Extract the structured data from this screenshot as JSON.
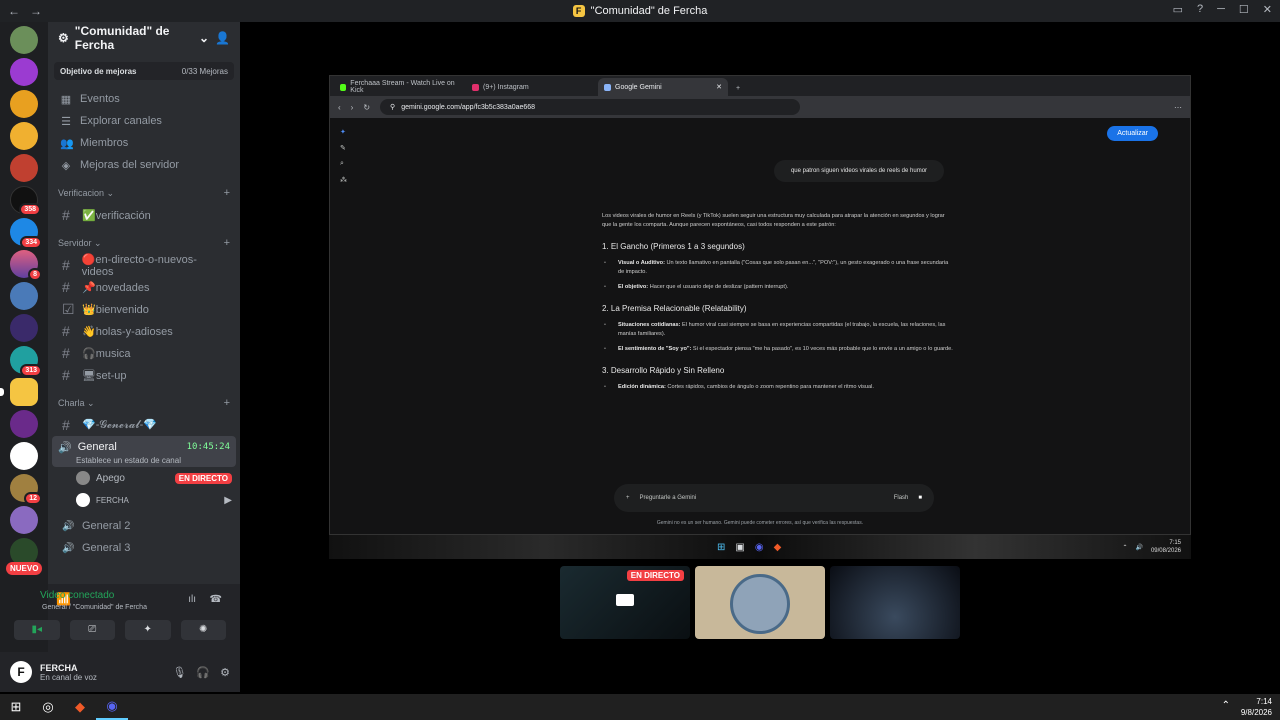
{
  "window": {
    "title": "\"Comunidad\" de Fercha",
    "logo_letter": "F"
  },
  "server": {
    "name": "\"Comunidad\" de Fercha",
    "boost": {
      "label": "Objetivo de mejoras",
      "value": "0/33 Mejoras"
    },
    "nav": [
      "Eventos",
      "Explorar canales",
      "Miembros",
      "Mejoras del servidor"
    ],
    "categories": {
      "verificacion": {
        "label": "Verificacion",
        "channels": [
          "✅verificación"
        ]
      },
      "servidor": {
        "label": "Servidor",
        "channels": [
          "🔴en-directo-o-nuevos-videos",
          "📌novedades",
          "👑bienvenido",
          "👋holas-y-adioses",
          "🎧musica",
          "🖥set-up"
        ]
      },
      "charla": {
        "label": "Charla",
        "channels": [
          "💎-𝓖𝓮𝓷𝓮𝓻𝓪𝓵-💎"
        ]
      }
    },
    "voice": {
      "active": {
        "name": "General",
        "timer": "10:45:24",
        "status": "Establece un estado de canal"
      },
      "users": [
        {
          "name": "Apego",
          "live": "EN DIRECTO"
        },
        {
          "name": "FERCHA"
        }
      ],
      "others": [
        "General 2",
        "General 3"
      ]
    }
  },
  "server_badges": [
    "358",
    "334",
    "8",
    "313",
    "12"
  ],
  "nuevo": "NUEVO",
  "connection": {
    "title": "Video conectado",
    "sub": "General / \"Comunidad\" de Fercha"
  },
  "user": {
    "name": "FERCHA",
    "status": "En canal de voz",
    "avatar_letter": "F"
  },
  "browser": {
    "tabs": [
      "Ferchaaa Stream - Watch Live on Kick",
      "(9+) Instagram",
      "Google Gemini"
    ],
    "url": "gemini.google.com/app/fc3b5c383a0ae668",
    "update_btn": "Actualizar",
    "question": "que patron siguen videos virales de reels de humor",
    "intro": "Los videos virales de humor en Reels (y TikTok) suelen seguir una estructura muy calculada para atrapar la atención en segundos y lograr que la gente los comparta. Aunque parecen espontáneos, casi todos responden a este patrón:",
    "s1": {
      "title": "1. El Gancho (Primeros 1 a 3 segundos)",
      "b1_bold": "Visual o Auditivo:",
      "b1": " Un texto llamativo en pantalla (\"Cosas que solo pasan en...\", \"POV:\"), un gesto exagerado o una frase secundaria de impacto.",
      "b2_bold": "El objetivo:",
      "b2": " Hacer que el usuario deje de deslizar (pattern interrupt)."
    },
    "s2": {
      "title": "2. La Premisa Relacionable (Relatability)",
      "b1_bold": "Situaciones cotidianas:",
      "b1": " El humor viral casi siempre se basa en experiencias compartidas (el trabajo, la escuela, las relaciones, las manías familiares).",
      "b2_bold": "El sentimiento de \"Soy yo\":",
      "b2": " Si el espectador piensa \"me ha pasado\", es 10 veces más probable que lo envíe a un amigo o lo guarde."
    },
    "s3": {
      "title": "3. Desarrollo Rápido y Sin Relleno",
      "b1_bold": "Edición dinámica:",
      "b1": " Cortes rápidos, cambios de ángulo o zoom repentino para mantener el ritmo visual."
    },
    "prompt_placeholder": "Preguntarle a Gemini",
    "model": "Flash",
    "disclaimer": "Gemini no es un ser humano. Gemini puede cometer errores, así que verifica las respuestas.",
    "inner_clock": {
      "time": "7:15",
      "date": "09/08/2026"
    }
  },
  "stream_live": "EN DIRECTO",
  "taskbar": {
    "time": "7:14",
    "date": "9/8/2026"
  },
  "colors": {
    "accent": "#23a55a",
    "live": "#f23f43",
    "blurple": "#5865f2"
  }
}
